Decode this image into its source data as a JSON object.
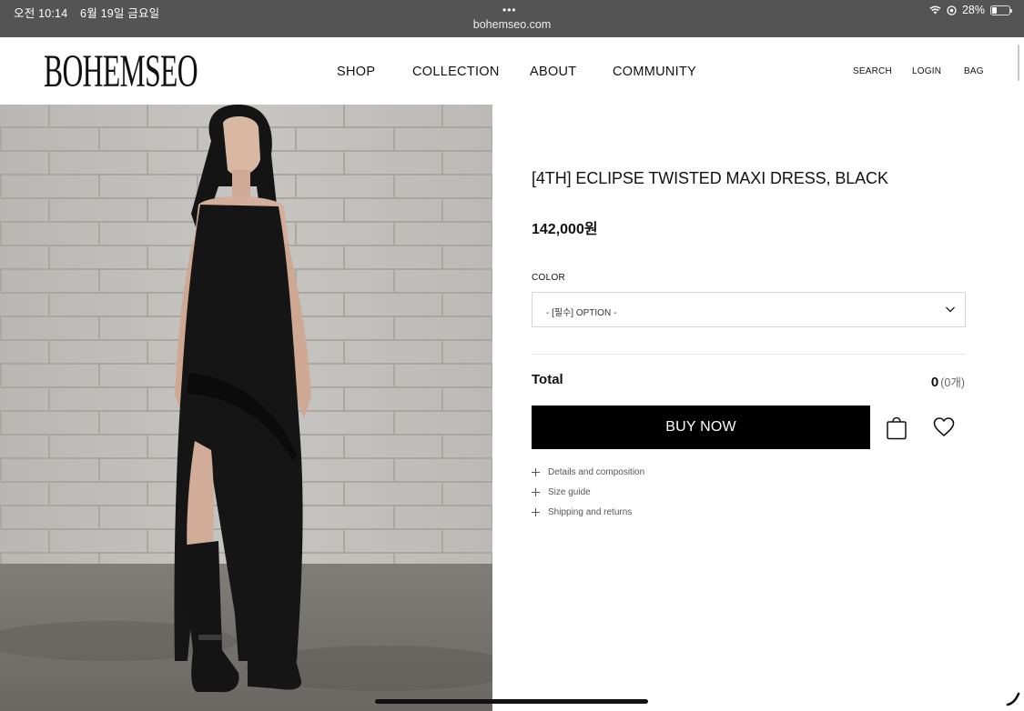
{
  "status_bar": {
    "time": "오전 10:14",
    "date": "6월 19일 금요일",
    "url": "bohemseo.com",
    "battery": "28%",
    "battery_level": 0.28
  },
  "header": {
    "logo": "BOHEMSEO",
    "nav": [
      "SHOP",
      "COLLECTION",
      "ABOUT",
      "COMMUNITY"
    ],
    "utility": [
      "SEARCH",
      "LOGIN",
      "BAG"
    ]
  },
  "product": {
    "title": "[4TH] ECLIPSE TWISTED MAXI DRESS, BLACK",
    "price": "142,000원",
    "color_label": "COLOR",
    "option_value": "- [필수] OPTION -",
    "total_label": "Total",
    "total_amount": "0",
    "total_count": "(0개)",
    "buy_label": "BUY NOW",
    "accordion": [
      "Details and composition",
      "Size guide",
      "Shipping and returns"
    ]
  },
  "icons": [
    "wifi-icon",
    "location-icon",
    "battery-icon",
    "chevron-down-icon",
    "shopping-bag-icon",
    "heart-icon",
    "plus-icon"
  ],
  "colors": {
    "status_bar_bg": "#545454",
    "button_bg": "#000000",
    "text": "#111111"
  }
}
